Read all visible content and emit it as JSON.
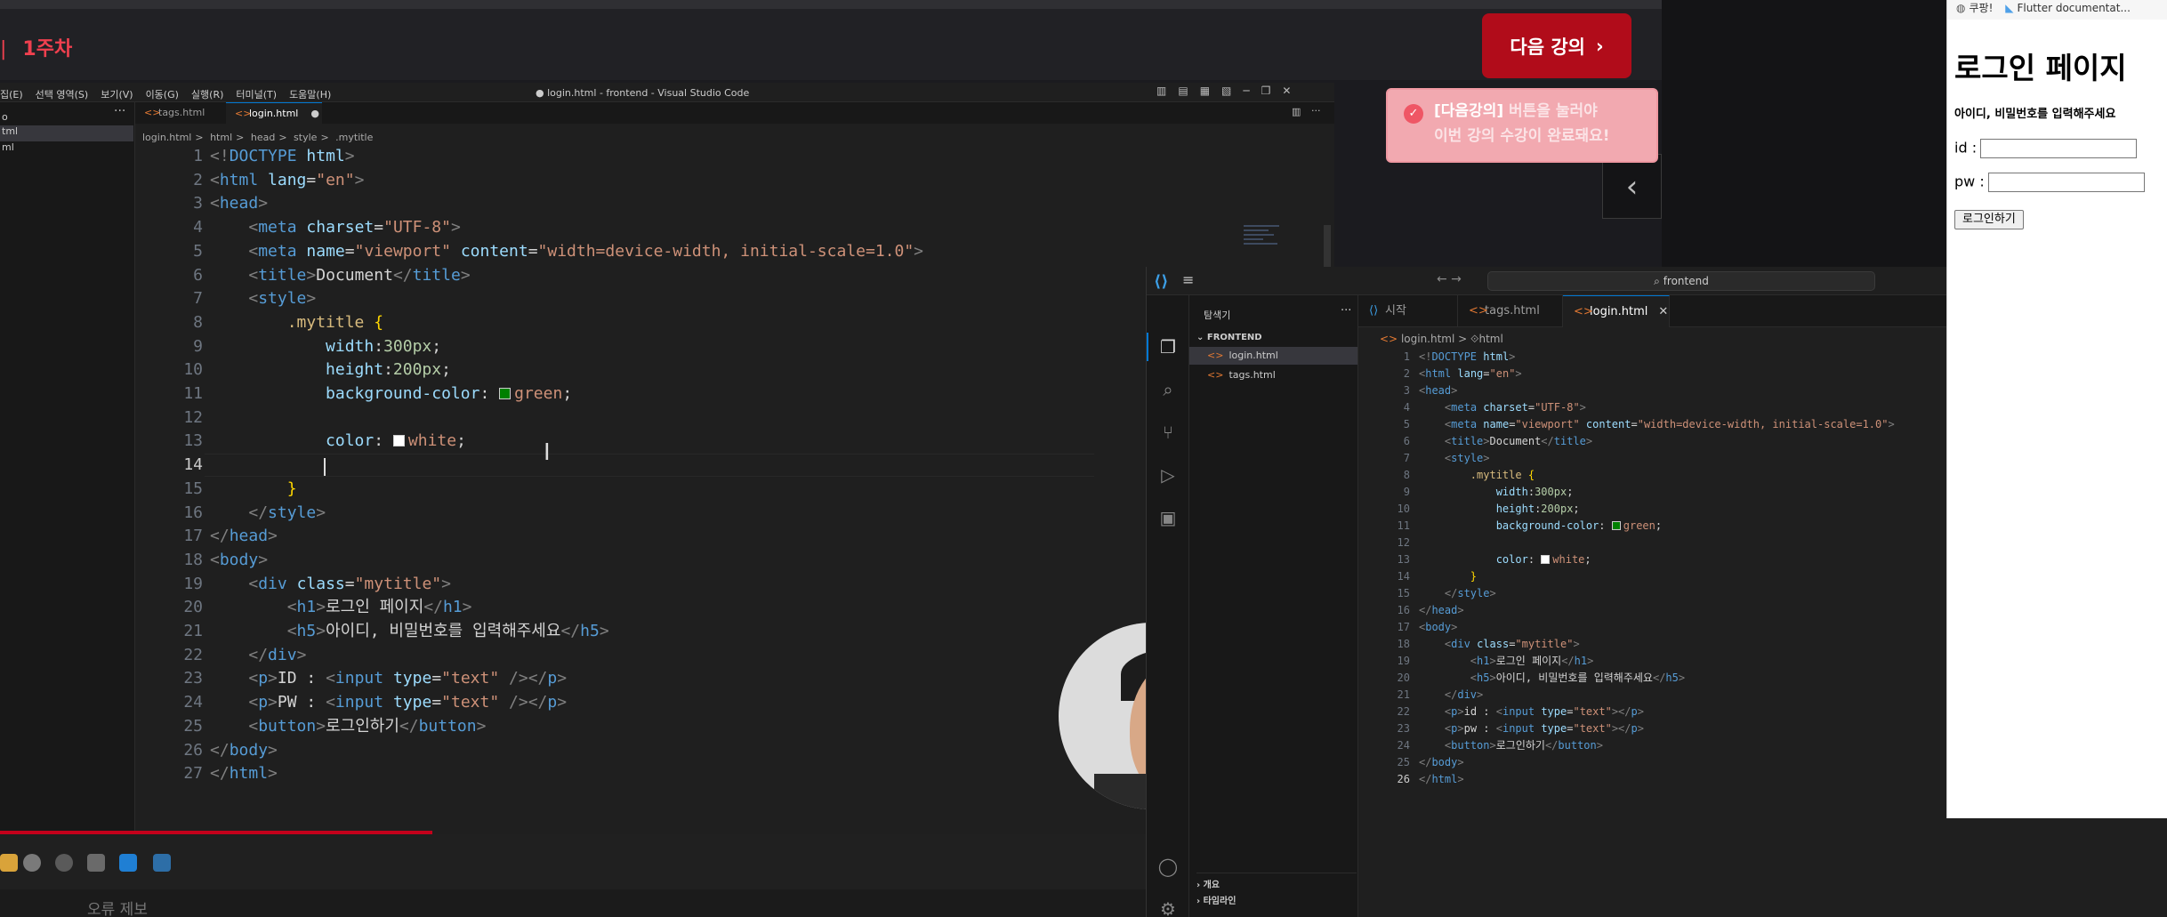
{
  "lecture": {
    "week_label": "1주차",
    "next_button": "다음 강의",
    "notice_highlight": "[다음강의]",
    "notice_line1_rest": " 버튼을 눌러야",
    "notice_line2": "이번 강의 수강이 완료돼요!"
  },
  "vscode_main": {
    "menu": [
      "집(E)",
      "선택 영역(S)",
      "보기(V)",
      "이동(G)",
      "실행(R)",
      "터미널(T)",
      "도움말(H)"
    ],
    "window_title": "● login.html - frontend - Visual Studio Code",
    "tabs": [
      {
        "label": "tags.html"
      },
      {
        "label": "login.html"
      }
    ],
    "unsaved_dot": "●",
    "breadcrumb": [
      "login.html",
      "html",
      "head",
      "style",
      ".mytitle"
    ],
    "sidebar_rows": [
      "o",
      "tml",
      "ml"
    ],
    "line_numbers": [
      "1",
      "2",
      "3",
      "4",
      "5",
      "6",
      "7",
      "8",
      "9",
      "10",
      "11",
      "12",
      "13",
      "14",
      "15",
      "16",
      "17",
      "18",
      "19",
      "20",
      "21",
      "22",
      "23",
      "24",
      "25",
      "26",
      "27"
    ],
    "colors": {
      "green_swatch": "#008000",
      "white_swatch": "#ffffff"
    }
  },
  "bottom": {
    "strip_text": "오류 제보"
  },
  "vscode_second": {
    "search": "frontend",
    "explorer_title": "탐색기",
    "folder": "FRONTEND",
    "files": [
      "login.html",
      "tags.html"
    ],
    "tabs": [
      {
        "label": "시작"
      },
      {
        "label": "tags.html"
      },
      {
        "label": "login.html"
      }
    ],
    "breadcrumb": [
      "login.html",
      "html"
    ],
    "sections": [
      "개요",
      "타임라인"
    ],
    "line_numbers": [
      "1",
      "2",
      "3",
      "4",
      "5",
      "6",
      "7",
      "8",
      "9",
      "10",
      "11",
      "12",
      "13",
      "14",
      "15",
      "16",
      "17",
      "18",
      "19",
      "20",
      "21",
      "22",
      "23",
      "24",
      "25",
      "26"
    ]
  },
  "browser": {
    "bookmarks": [
      "쿠팡!",
      "Flutter documentat..."
    ],
    "h1": "로그인 페이지",
    "h5": "아이디, 비밀번호를 입력해주세요",
    "id_label": "id :",
    "pw_label": "pw :",
    "login_button": "로그인하기"
  }
}
